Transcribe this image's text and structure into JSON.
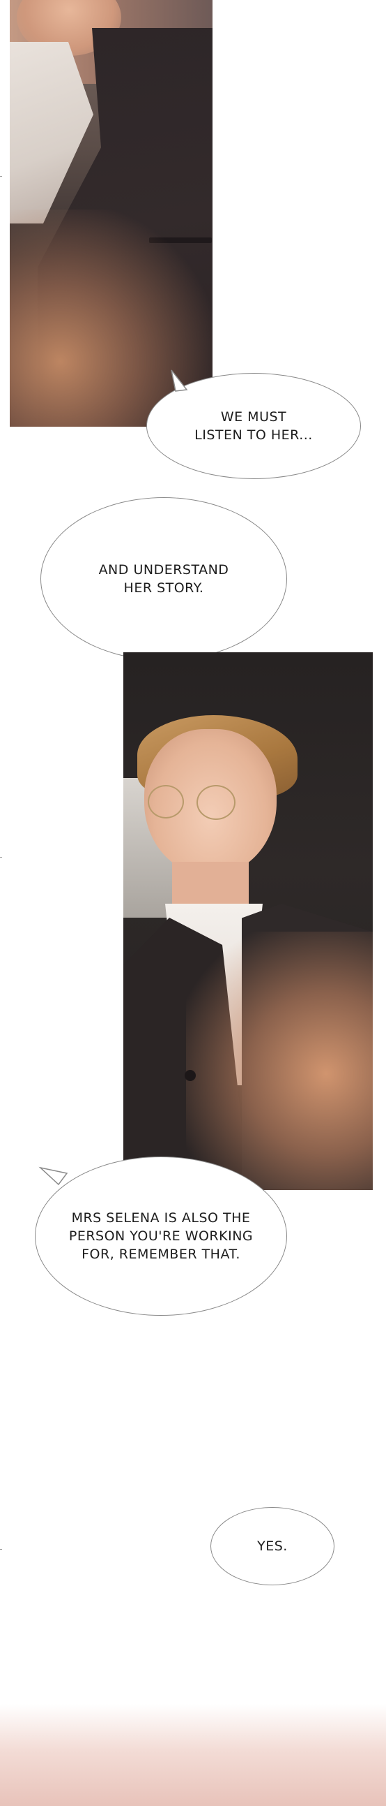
{
  "page": {
    "background": "#ffffff"
  },
  "bubbles": [
    {
      "id": "listen",
      "text": "WE MUST\nLISTEN TO HER..."
    },
    {
      "id": "understand",
      "text": "AND UNDERSTAND\nHER STORY."
    },
    {
      "id": "selena",
      "text": "MRS SELENA IS ALSO THE\nPERSON YOU'RE WORKING\nFOR, REMEMBER THAT."
    },
    {
      "id": "yes",
      "text": "YES."
    }
  ],
  "colors": {
    "bubble_border": "#8a8a8a",
    "text": "#1d1d1d",
    "warm_glow": "#d6966c"
  }
}
